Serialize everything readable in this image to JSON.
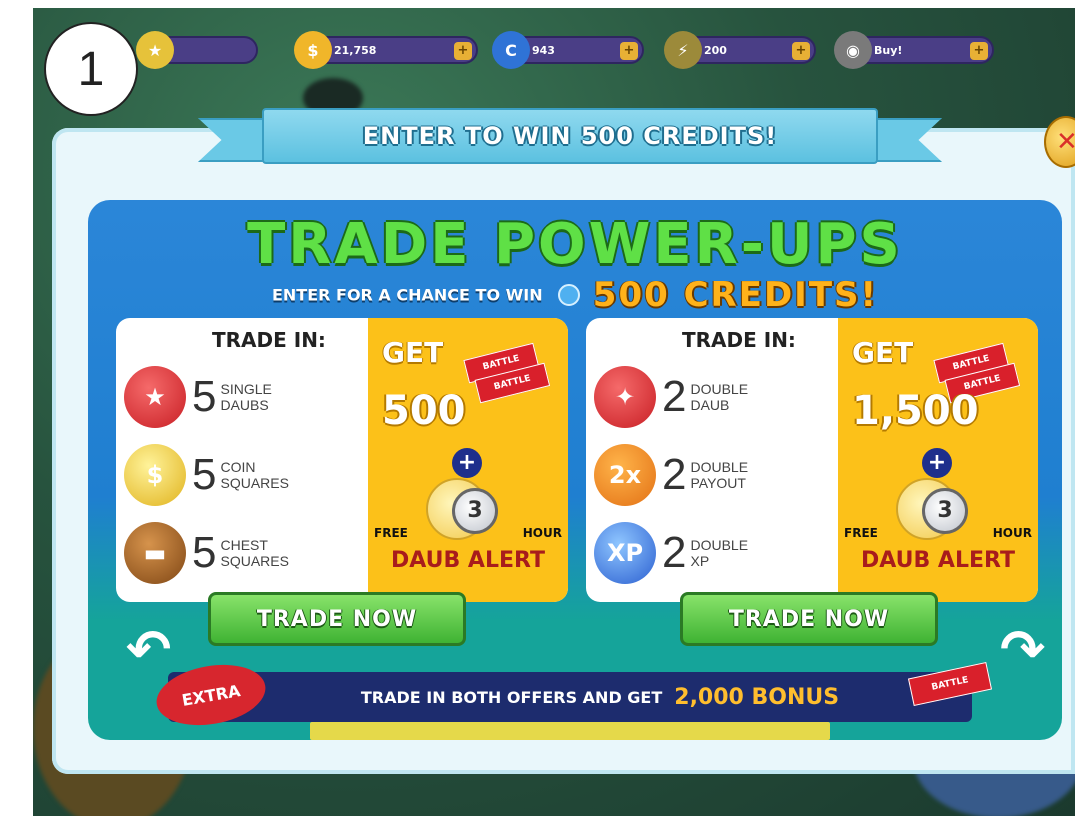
{
  "step_badge": "1",
  "hud": [
    {
      "icon": "star-icon",
      "value": ""
    },
    {
      "icon": "coin-icon",
      "value": "21,758"
    },
    {
      "icon": "credit-icon",
      "value": "943"
    },
    {
      "icon": "power-up-icon",
      "value": "200"
    },
    {
      "icon": "globe-icon",
      "value": "Buy!"
    }
  ],
  "banner": "ENTER TO WIN 500 CREDITS!",
  "title": "TRADE POWER-UPS",
  "subtitle": {
    "small": "ENTER FOR A CHANCE TO WIN",
    "big": "500 CREDITS!"
  },
  "offers": [
    {
      "trade_in_label": "TRADE IN:",
      "items": [
        {
          "icon": "star-daub-icon",
          "qty": "5",
          "line1": "SINGLE",
          "line2": "DAUBS"
        },
        {
          "icon": "coin-square-icon",
          "qty": "5",
          "line1": "COIN",
          "line2": "SQUARES"
        },
        {
          "icon": "chest-square-icon",
          "qty": "5",
          "line1": "CHEST",
          "line2": "SQUARES"
        }
      ],
      "get_label": "GET",
      "get_amount": "500",
      "ticket_label": "BATTLE",
      "plus": "+",
      "clock_number": "3",
      "free_label": "FREE",
      "hour_label": "HOUR",
      "alert_label": "DAUB ALERT",
      "button": "TRADE NOW"
    },
    {
      "trade_in_label": "TRADE IN:",
      "items": [
        {
          "icon": "double-daub-icon",
          "qty": "2",
          "line1": "DOUBLE",
          "line2": "DAUB"
        },
        {
          "icon": "double-payout-icon",
          "qty": "2",
          "line1": "DOUBLE",
          "line2": "PAYOUT",
          "badge": "2x"
        },
        {
          "icon": "double-xp-icon",
          "qty": "2",
          "line1": "DOUBLE",
          "line2": "XP",
          "badge": "XP"
        }
      ],
      "get_label": "GET",
      "get_amount": "1,500",
      "ticket_label": "BATTLE",
      "plus": "+",
      "clock_number": "3",
      "free_label": "FREE",
      "hour_label": "HOUR",
      "alert_label": "DAUB ALERT",
      "button": "TRADE NOW"
    }
  ],
  "bonus": {
    "extra": "EXTRA",
    "text": "TRADE IN BOTH OFFERS AND GET",
    "amount": "2,000 BONUS",
    "ticket_label": "BATTLE"
  },
  "colors": {
    "panel_blue": "#2b86d8",
    "panel_teal": "#15a49a",
    "get_yellow": "#fcc119",
    "title_green": "#5fe046",
    "button_green": "#3fb333",
    "bonus_navy": "#1d2c6e"
  }
}
